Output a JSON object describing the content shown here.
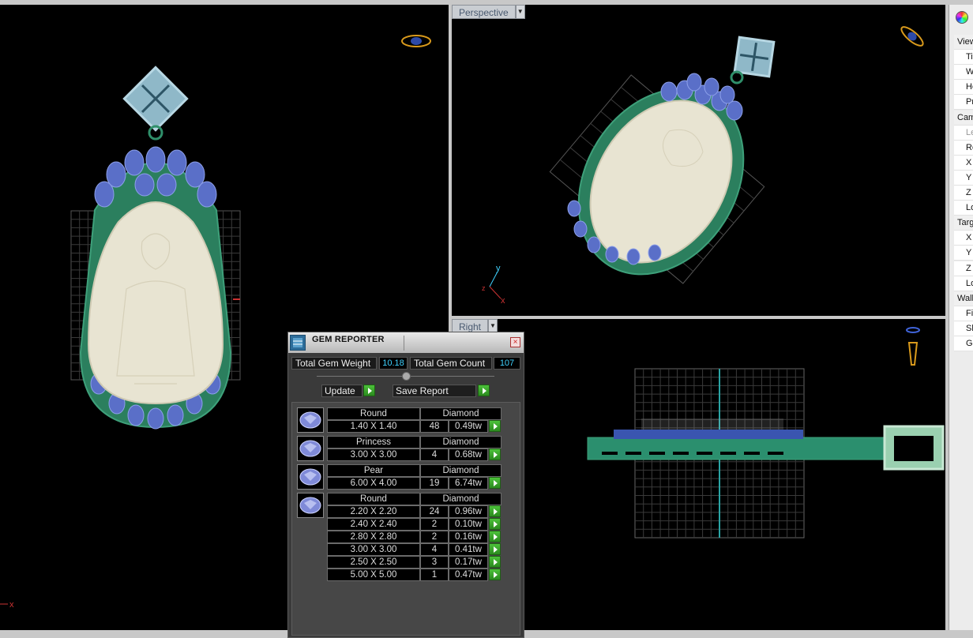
{
  "viewports": {
    "top": {
      "axis_x": "x"
    },
    "perspective": {
      "label": "Perspective",
      "axis_x": "x",
      "axis_y": "y",
      "axis_z": "z"
    },
    "right": {
      "label": "Right"
    }
  },
  "side_panel": {
    "rows": [
      "View",
      "Tit",
      "W",
      "He",
      "Pr",
      "Cam",
      "Le",
      "Ro",
      "X",
      "Y",
      "Z",
      "Lo",
      "Targ",
      "X",
      "Y",
      "Z",
      "Lo",
      "Wall",
      "Fil",
      "Sh",
      "Gr"
    ]
  },
  "gem_reporter": {
    "title": "GEM REPORTER",
    "close": "×",
    "total_weight_label": "Total Gem Weight",
    "total_weight_value": "10.18",
    "total_count_label": "Total Gem Count",
    "total_count_value": "107",
    "update_label": "Update",
    "save_report_label": "Save Report",
    "groups": [
      {
        "shape": "Round",
        "material": "Diamond",
        "icon": "round-gem-icon",
        "rows": [
          {
            "size": "1.40 X 1.40",
            "count": "48",
            "weight": "0.49tw"
          }
        ]
      },
      {
        "shape": "Princess",
        "material": "Diamond",
        "icon": "princess-gem-icon",
        "rows": [
          {
            "size": "3.00 X 3.00",
            "count": "4",
            "weight": "0.68tw"
          }
        ]
      },
      {
        "shape": "Pear",
        "material": "Diamond",
        "icon": "pear-gem-icon",
        "rows": [
          {
            "size": "6.00 X 4.00",
            "count": "19",
            "weight": "6.74tw"
          }
        ]
      },
      {
        "shape": "Round",
        "material": "Diamond",
        "icon": "round-gem-icon",
        "rows": [
          {
            "size": "2.20 X 2.20",
            "count": "24",
            "weight": "0.96tw"
          },
          {
            "size": "2.40 X 2.40",
            "count": "2",
            "weight": "0.10tw"
          },
          {
            "size": "2.80 X 2.80",
            "count": "2",
            "weight": "0.16tw"
          },
          {
            "size": "3.00 X 3.00",
            "count": "4",
            "weight": "0.41tw"
          },
          {
            "size": "2.50 X 2.50",
            "count": "3",
            "weight": "0.17tw"
          },
          {
            "size": "5.00 X 5.00",
            "count": "1",
            "weight": "0.47tw"
          }
        ]
      }
    ]
  },
  "colors": {
    "jade": "#e8e4d2",
    "gem_blue": "#5a6fc8",
    "metal_green": "#2f8f6a",
    "accent_cyan": "#3fd2ff"
  }
}
